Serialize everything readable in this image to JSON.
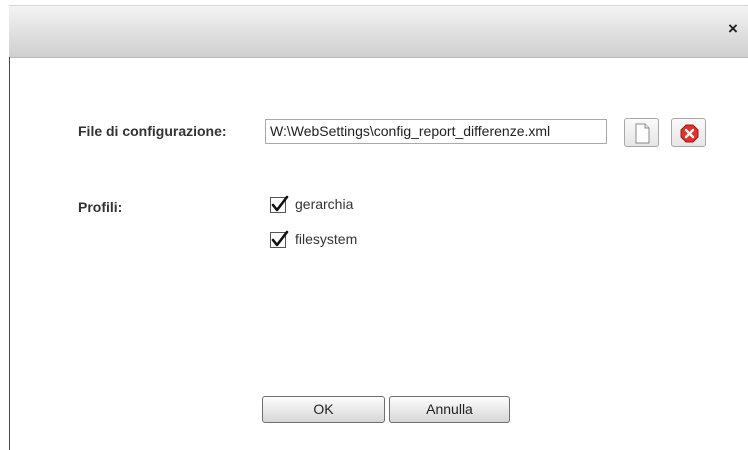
{
  "dialog": {
    "close_label": "×"
  },
  "config": {
    "label": "File di configurazione:",
    "value": "W:\\WebSettings\\config_report_differenze.xml",
    "new_icon": "document-icon",
    "remove_icon": "remove-icon"
  },
  "profiles": {
    "label": "Profili:",
    "items": [
      {
        "label": "gerarchia",
        "checked": true
      },
      {
        "label": "filesystem",
        "checked": true
      }
    ]
  },
  "buttons": {
    "ok_label": "OK",
    "cancel_label": "Annulla"
  },
  "colors": {
    "remove_icon": "#e0302a"
  }
}
